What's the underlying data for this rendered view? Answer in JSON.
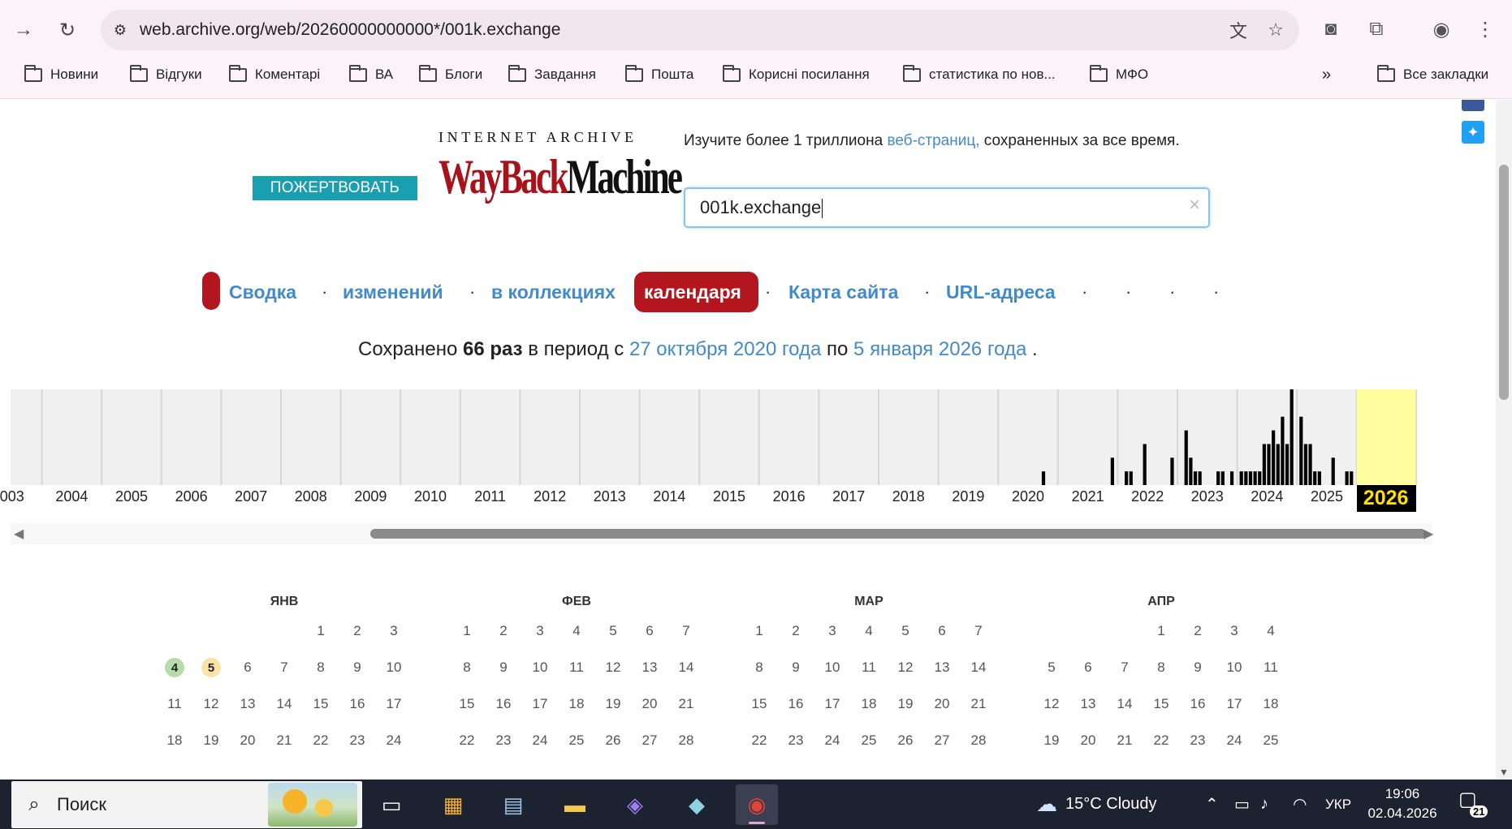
{
  "browser": {
    "url": "web.archive.org/web/20260000000000*/001k.exchange",
    "bookmarks": [
      "Новини",
      "Відгуки",
      "Коментарі",
      "ВА",
      "Блоги",
      "Завдання",
      "Пошта",
      "Корисні посилання",
      "статистика по нов...",
      "МФО"
    ],
    "overflow": "»",
    "all_bookmarks": "Все закладки"
  },
  "wayback": {
    "donate": "ПОЖЕРТВОВАТЬ",
    "logo_top": "INTERNET ARCHIVE",
    "logo_wayback": "WayBack",
    "logo_machine": "Machine",
    "tagline_pre": "Изучите более 1 триллиона ",
    "tagline_link": "веб-страниц,",
    "tagline_post": " сохраненных за все время.",
    "search_value": "001k.exchange",
    "clear": "×",
    "tabs": [
      "Сводка",
      "изменений",
      "в коллекциях",
      "календаря",
      "Карта сайта",
      "URL-адреса"
    ],
    "active_tab": "календаря",
    "saved_pre": "Сохранено ",
    "saved_count": "66 раз",
    "saved_mid": " в период с ",
    "saved_from": "27 октября 2020 года",
    "saved_and": " по ",
    "saved_to": "5 января 2026 года",
    "saved_end": " ."
  },
  "chart_data": {
    "type": "bar",
    "title": "",
    "years": [
      "003",
      "2004",
      "2005",
      "2006",
      "2007",
      "2008",
      "2009",
      "2010",
      "2011",
      "2012",
      "2013",
      "2014",
      "2015",
      "2016",
      "2017",
      "2018",
      "2019",
      "2020",
      "2021",
      "2022",
      "2023",
      "2024",
      "2025",
      "2026"
    ],
    "selected_year": "2026",
    "monthly_captures": {
      "2020": [
        0,
        0,
        0,
        0,
        0,
        0,
        0,
        0,
        0,
        1,
        0,
        0
      ],
      "2021": [
        0,
        0,
        0,
        0,
        0,
        0,
        0,
        0,
        0,
        0,
        0,
        2
      ],
      "2022": [
        0,
        1,
        1,
        0,
        0,
        3,
        0,
        0,
        0,
        0,
        0,
        2
      ],
      "2023": [
        0,
        4,
        2,
        1,
        1,
        0,
        0,
        0,
        1,
        1,
        0,
        1
      ],
      "2024": [
        1,
        1,
        1,
        1,
        1,
        3,
        3,
        4,
        3,
        5,
        3,
        7
      ],
      "2025": [
        5,
        3,
        3,
        1,
        1,
        0,
        0,
        2,
        0,
        0,
        1,
        1
      ],
      "2026": [
        0,
        0,
        0,
        0,
        0,
        0,
        0,
        0,
        0,
        0,
        0,
        0
      ]
    }
  },
  "calendar": {
    "months": [
      {
        "name": "ЯНВ",
        "weeks": [
          [
            "",
            "",
            "",
            "",
            "1",
            "2",
            "3"
          ],
          [
            "4",
            "5",
            "6",
            "7",
            "8",
            "9",
            "10"
          ],
          [
            "11",
            "12",
            "13",
            "14",
            "15",
            "16",
            "17"
          ],
          [
            "18",
            "19",
            "20",
            "21",
            "22",
            "23",
            "24"
          ]
        ]
      },
      {
        "name": "ФЕВ",
        "weeks": [
          [
            "1",
            "2",
            "3",
            "4",
            "5",
            "6",
            "7"
          ],
          [
            "8",
            "9",
            "10",
            "11",
            "12",
            "13",
            "14"
          ],
          [
            "15",
            "16",
            "17",
            "18",
            "19",
            "20",
            "21"
          ],
          [
            "22",
            "23",
            "24",
            "25",
            "26",
            "27",
            "28"
          ]
        ]
      },
      {
        "name": "МАР",
        "weeks": [
          [
            "1",
            "2",
            "3",
            "4",
            "5",
            "6",
            "7"
          ],
          [
            "8",
            "9",
            "10",
            "11",
            "12",
            "13",
            "14"
          ],
          [
            "15",
            "16",
            "17",
            "18",
            "19",
            "20",
            "21"
          ],
          [
            "22",
            "23",
            "24",
            "25",
            "26",
            "27",
            "28"
          ]
        ]
      },
      {
        "name": "АПР",
        "weeks": [
          [
            "",
            "",
            "",
            "1",
            "2",
            "3",
            "4"
          ],
          [
            "5",
            "6",
            "7",
            "8",
            "9",
            "10",
            "11"
          ],
          [
            "12",
            "13",
            "14",
            "15",
            "16",
            "17",
            "18"
          ],
          [
            "19",
            "20",
            "21",
            "22",
            "23",
            "24",
            "25"
          ]
        ]
      }
    ],
    "highlight_green": "4",
    "highlight_yellow": "5"
  },
  "taskbar": {
    "search": "Поиск",
    "weather": "15°C  Cloudy",
    "lang": "УКР",
    "time": "19:06",
    "date": "02.04.2026",
    "notifications": "21"
  },
  "colors": {
    "accent_red": "#b3161e",
    "link_blue": "#428bca",
    "donate_teal": "#1a9fb0",
    "selected_year_bg": "#ffffa0"
  }
}
